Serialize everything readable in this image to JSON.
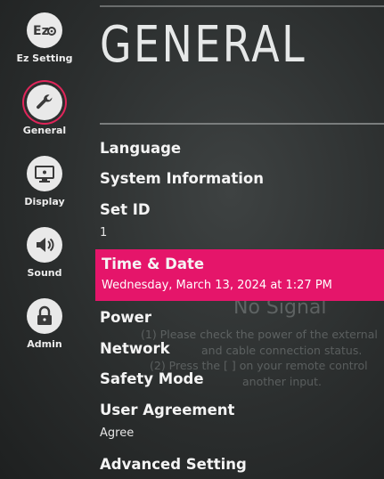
{
  "sidebar": {
    "items": [
      {
        "label": "Ez Setting",
        "icon": "ez-setting-icon",
        "glyph": "E"
      },
      {
        "label": "General",
        "icon": "wrench-icon",
        "active": true
      },
      {
        "label": "Display",
        "icon": "display-icon"
      },
      {
        "label": "Sound",
        "icon": "speaker-icon"
      },
      {
        "label": "Admin",
        "icon": "lock-icon"
      }
    ]
  },
  "header": {
    "title": "GENERAL"
  },
  "menu": {
    "language": {
      "label": "Language"
    },
    "system_information": {
      "label": "System Information"
    },
    "set_id": {
      "label": "Set ID",
      "value": "1"
    },
    "time_date": {
      "label": "Time & Date",
      "value": "Wednesday, March 13, 2024 at 1:27 PM"
    },
    "power": {
      "label": "Power"
    },
    "network": {
      "label": "Network"
    },
    "safety_mode": {
      "label": "Safety Mode"
    },
    "user_agreement": {
      "label": "User Agreement",
      "value": "Agree"
    },
    "advanced_setting": {
      "label": "Advanced Setting"
    }
  },
  "no_signal": {
    "title": "No Signal",
    "line1": "(1) Please check the power of the external",
    "line2": "and cable connection status.",
    "line3": "(2) Press the [ ] on your remote control",
    "line4": "another input."
  },
  "colors": {
    "accent": "#e5156a",
    "background": "#2f3232"
  }
}
